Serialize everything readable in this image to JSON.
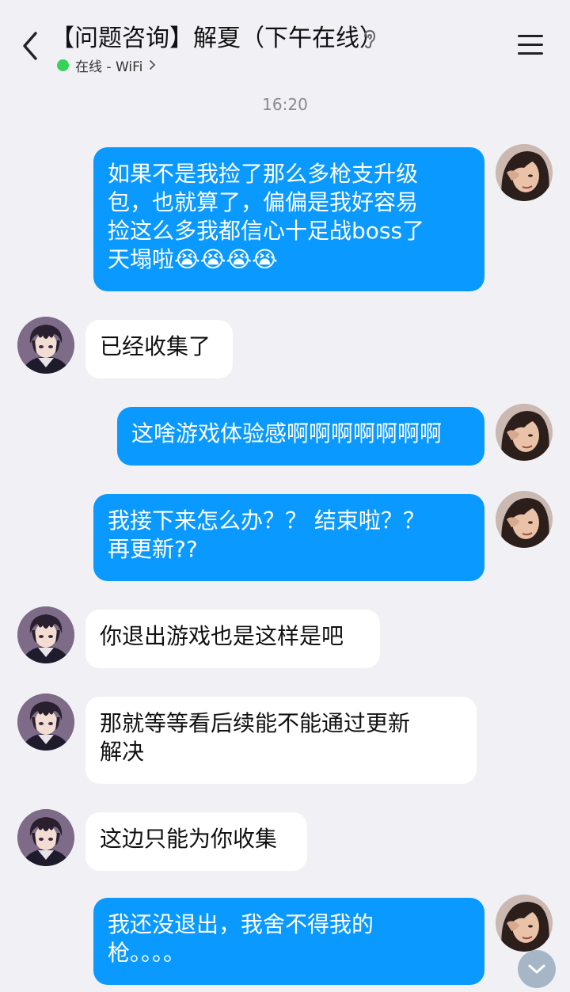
{
  "header": {
    "title": "【问题咨询】解夏（下午在线）",
    "status": "在线 - WiFi",
    "status_color": "#35d35a"
  },
  "icons": {
    "back": "chevron-left-icon",
    "ear": "ear-icon",
    "menu": "menu-icon",
    "scroll": "chevron-down-icon"
  },
  "timestamp": "16:20",
  "messages": [
    {
      "sender": "me",
      "text": "如果不是我捡了那么多枪支升级\n包，也就算了，偏偏是我好容易\n捡这么多我都信心十足战boss了\n天塌啦😭😭😭😭"
    },
    {
      "sender": "them",
      "text": "已经收集了"
    },
    {
      "sender": "me",
      "text": "这啥游戏体验感啊啊啊啊啊啊啊"
    },
    {
      "sender": "me",
      "text": "我接下来怎么办？？ 结束啦？？\n再更新??"
    },
    {
      "sender": "them",
      "text": "你退出游戏也是这样是吧"
    },
    {
      "sender": "them",
      "text": "那就等等看后续能不能通过更新\n解决"
    },
    {
      "sender": "them",
      "text": "这边只能为你收集"
    },
    {
      "sender": "me",
      "text": "我还没退出，我舍不得我的\n枪。。。。"
    }
  ],
  "colors": {
    "my_bubble": "#0a99ff",
    "their_bubble": "#ffffff",
    "background": "#f1f1f5"
  }
}
